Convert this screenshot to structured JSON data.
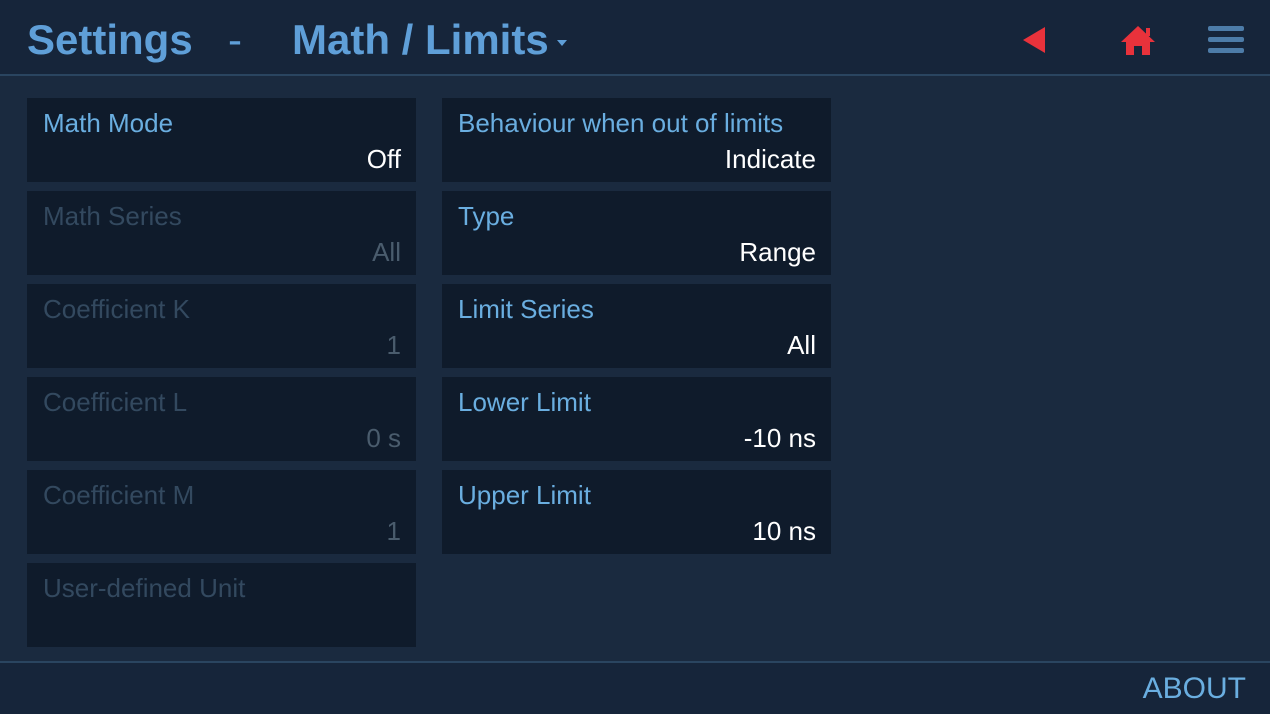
{
  "header": {
    "title": "Settings",
    "separator": "-",
    "page": "Math / Limits",
    "icons": {
      "back": "back-arrow-icon",
      "home": "home-icon",
      "menu": "hamburger-menu-icon"
    }
  },
  "left_column": [
    {
      "label": "Math Mode",
      "value": "Off",
      "enabled": true
    },
    {
      "label": "Math Series",
      "value": "All",
      "enabled": false
    },
    {
      "label": "Coefficient K",
      "value": "1",
      "enabled": false
    },
    {
      "label": "Coefficient L",
      "value": "0 s",
      "enabled": false
    },
    {
      "label": "Coefficient M",
      "value": "1",
      "enabled": false
    },
    {
      "label": "User-defined Unit",
      "value": "",
      "enabled": false
    }
  ],
  "right_column": [
    {
      "label": "Behaviour when out of limits",
      "value": "Indicate",
      "enabled": true
    },
    {
      "label": "Type",
      "value": "Range",
      "enabled": true
    },
    {
      "label": "Limit Series",
      "value": "All",
      "enabled": true
    },
    {
      "label": "Lower Limit",
      "value": "-10 ns",
      "enabled": true
    },
    {
      "label": "Upper Limit",
      "value": "10 ns",
      "enabled": true
    }
  ],
  "footer": {
    "about_label": "ABOUT"
  },
  "colors": {
    "background": "#1a2a3f",
    "card": "#0f1b2b",
    "accent": "#5f9fd8",
    "icon_red": "#e8323b",
    "menu_icon": "#4d7ca8"
  }
}
